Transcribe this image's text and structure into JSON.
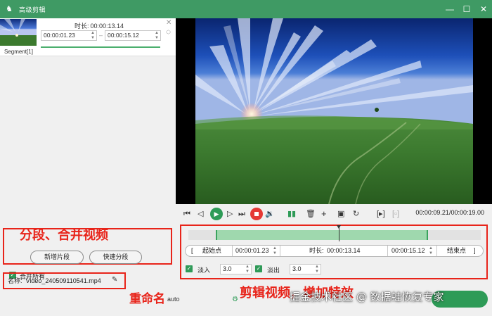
{
  "window": {
    "title": "高级剪辑",
    "controls": {
      "minimize": "—",
      "maximize": "☐",
      "close": "✕"
    }
  },
  "segment": {
    "duration_label": "时长:",
    "duration": "00:00:13.14",
    "start": "00:00:01.23",
    "end": "00:00:15.12",
    "label": "Segment[1]"
  },
  "left_buttons": {
    "new_segment": "新增片段",
    "quick_split": "快速分段",
    "merge_all": "合并所有",
    "merge_all_checked": true
  },
  "file": {
    "name_label": "名称:",
    "name_value": "Video_240509110541.mp4"
  },
  "annotations": {
    "split_merge": "分段、合并视频",
    "rename": "重命名",
    "cut_effects": "剪辑视频，增加特效"
  },
  "player": {
    "current_time": "00:00:09.21",
    "total_time": "00:00:19.00",
    "icons": [
      "skip-start-icon",
      "prev-frame-icon",
      "play-icon",
      "next-frame-icon",
      "skip-end-icon",
      "stop-icon",
      "volume-icon",
      "split-icon",
      "delete-icon",
      "add-icon",
      "copy-icon",
      "reset-icon",
      "mark-in-icon",
      "mark-out-icon"
    ]
  },
  "cut": {
    "start_label": "起始点",
    "start_value": "00:00:01.23",
    "duration_label": "时长:",
    "duration_value": "00:00:13.14",
    "end_value": "00:00:15.12",
    "end_label": "结束点",
    "progress_start": 0.065,
    "progress_end": 0.795,
    "playhead": 0.485
  },
  "effects": {
    "fade_in_label": "淡入",
    "fade_in_value": "3.0",
    "fade_in_checked": true,
    "fade_out_label": "淡出",
    "fade_out_value": "3.0",
    "fade_out_checked": true
  },
  "bottom": {
    "auto_text": "auto"
  },
  "watermark": "掘金技术社区 @ 数据蛙恢复专家",
  "colors": {
    "accent": "#3f9a64",
    "annotation_red": "#e8241a",
    "stop_red": "#e53935"
  }
}
